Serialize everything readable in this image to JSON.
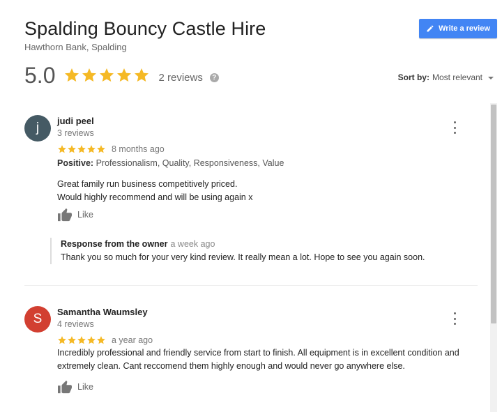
{
  "business": {
    "name": "Spalding Bouncy Castle Hire",
    "address": "Hawthorn Bank, Spalding",
    "rating": "5.0",
    "stars": 5,
    "review_count": "2 reviews"
  },
  "actions": {
    "write_review_label": "Write a review",
    "help_icon": "?"
  },
  "sort": {
    "label": "Sort by:",
    "value": "Most relevant"
  },
  "colors": {
    "accent": "#4285f4",
    "star": "#f5b925",
    "avatar_1": "#455a64",
    "avatar_2": "#d23f31"
  },
  "reviews": [
    {
      "initial": "j",
      "author": "judi peel",
      "author_reviews": "3 reviews",
      "stars": 5,
      "time": "8 months ago",
      "positive_label": "Positive:",
      "positive_text": "Professionalism, Quality, Responsiveness, Value",
      "text": "Great family run business competitively priced.\nWould highly recommend and will be using again x",
      "like_label": "Like",
      "owner_response": {
        "label": "Response from the owner",
        "time": "a week ago",
        "text": "Thank you so much for your very kind review. It really mean a lot. Hope to see you again soon."
      }
    },
    {
      "initial": "S",
      "author": "Samantha Waumsley",
      "author_reviews": "4 reviews",
      "stars": 5,
      "time": "a year ago",
      "text": "Incredibly professional and friendly service from start to finish. All equipment is in excellent condition and extremely clean. Cant reccomend them highly enough and would never go anywhere else.",
      "like_label": "Like"
    }
  ]
}
